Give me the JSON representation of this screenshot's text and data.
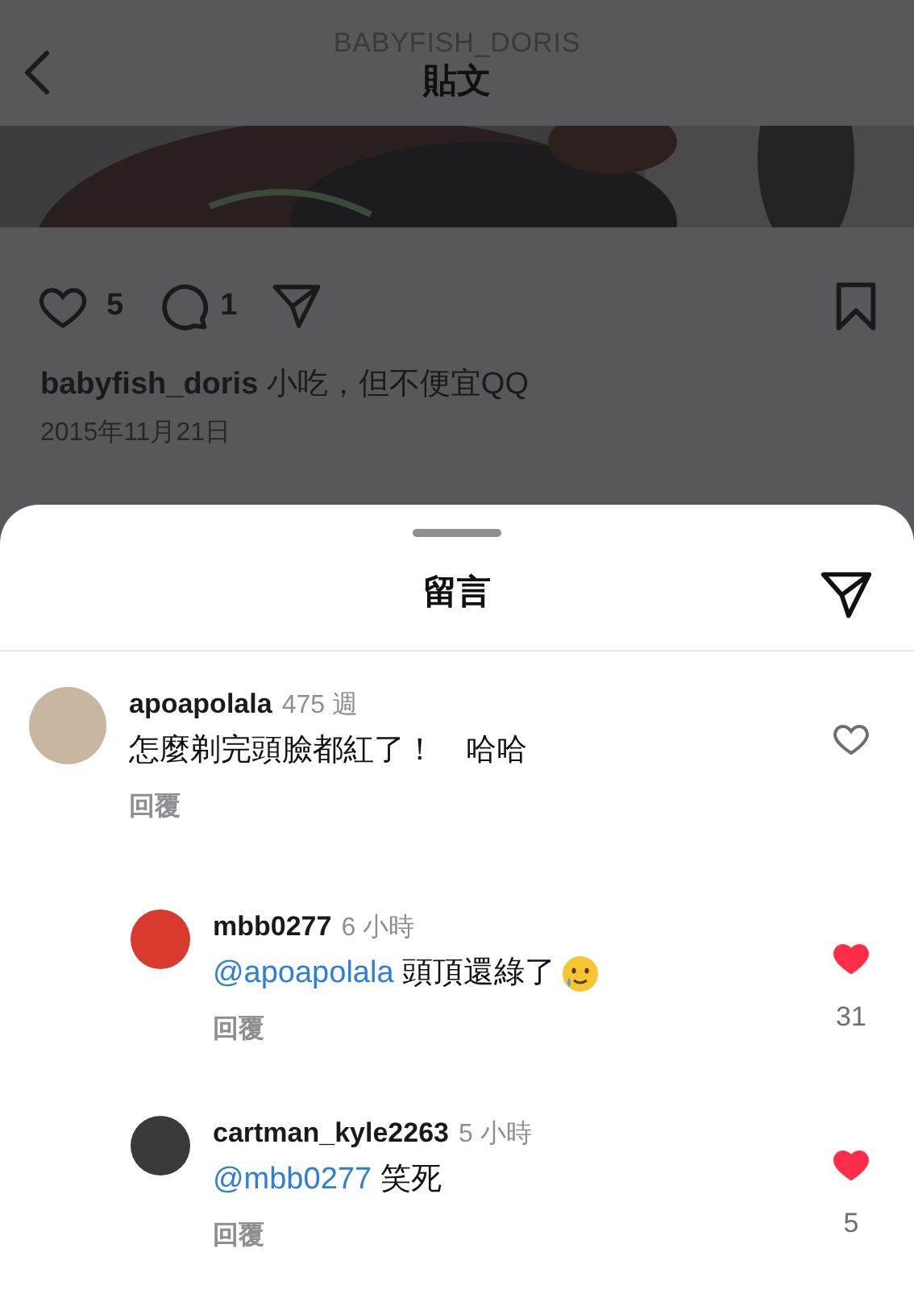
{
  "header": {
    "username": "BABYFISH_DORIS",
    "title": "貼文"
  },
  "actions": {
    "likes": "5",
    "comments": "1"
  },
  "caption": {
    "username": "babyfish_doris",
    "text": "小吃，但不便宜QQ"
  },
  "date": "2015年11月21日",
  "sheet": {
    "title": "留言"
  },
  "comments": [
    {
      "username": "apoapolala",
      "time": "475 週",
      "text": "怎麼剃完頭臉都紅了！　哈哈",
      "trailing_emoji": false,
      "reply": "回覆",
      "liked": false,
      "reply_level": false
    },
    {
      "username": "mbb0277",
      "time": "6 小時",
      "mention": "@apoapolala",
      "text": "頭頂還綠了",
      "trailing_emoji": true,
      "reply": "回覆",
      "liked": true,
      "like_count": "31",
      "reply_level": true
    },
    {
      "username": "cartman_kyle2263",
      "time": "5 小時",
      "mention": "@mbb0277",
      "text": "笑死",
      "trailing_emoji": false,
      "reply": "回覆",
      "liked": true,
      "like_count": "5",
      "reply_level": true
    }
  ]
}
